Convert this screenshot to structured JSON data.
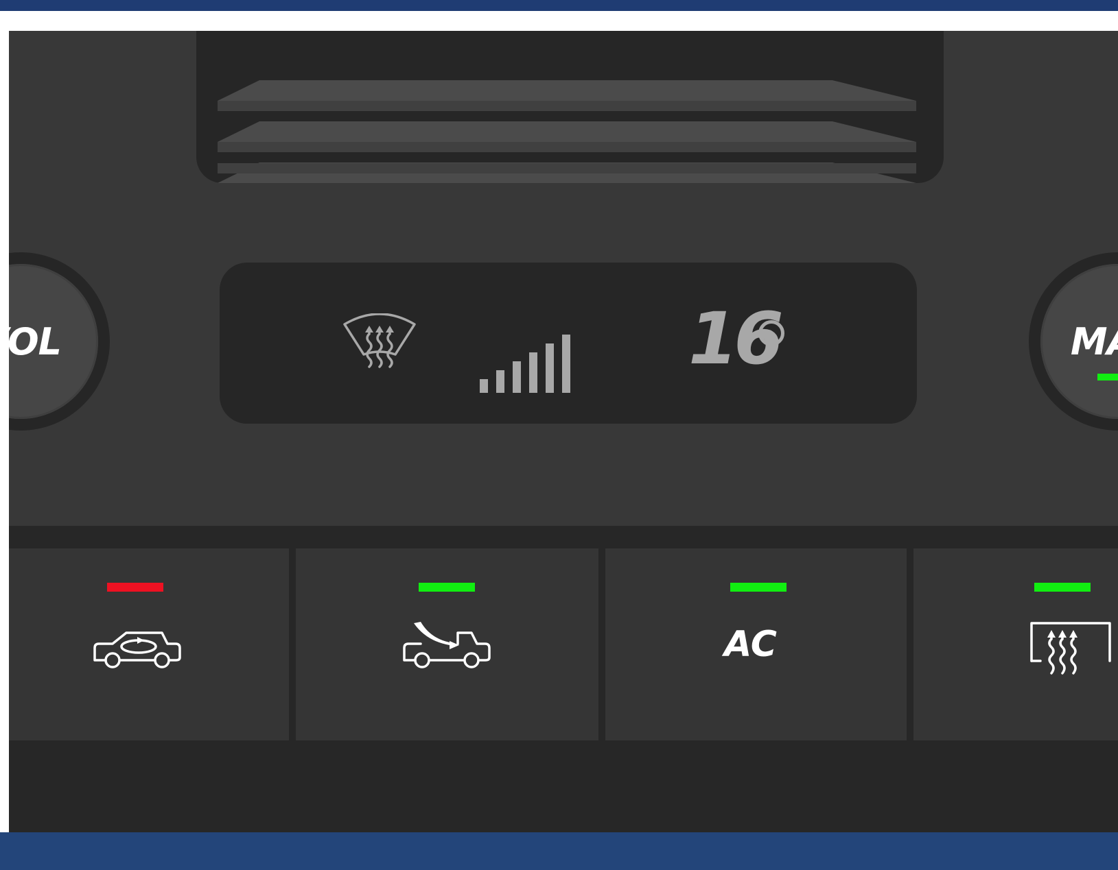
{
  "colors": {
    "frame_top": "#1f3c73",
    "frame_bottom": "#23457a",
    "panel": "#383838",
    "indicator_on": "#11ee11",
    "indicator_off": "#ee1122",
    "ring_accent": "#1a86ff",
    "display_text": "#a8a8a8"
  },
  "knobs": {
    "left": {
      "label": "VOL"
    },
    "right": {
      "label": "MAX",
      "indicator": "on"
    }
  },
  "display": {
    "mode_icon": "windshield-defrost-icon",
    "fan_level": 6,
    "fan_max": 6,
    "temperature": "16"
  },
  "buttons": [
    {
      "id": "recirculation",
      "icon": "car-recirculation-icon",
      "indicator": "off"
    },
    {
      "id": "fresh-air",
      "icon": "car-fresh-air-icon",
      "indicator": "on"
    },
    {
      "id": "ac",
      "label": "AC",
      "indicator": "on"
    },
    {
      "id": "rear-defrost",
      "icon": "rear-defrost-icon",
      "indicator": "on"
    }
  ]
}
